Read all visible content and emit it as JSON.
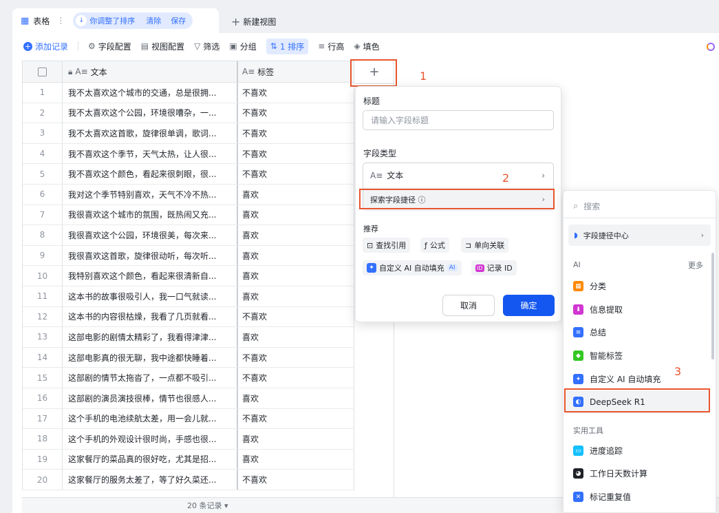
{
  "tabbar": {
    "tab_label": "表格",
    "sort_pill_text": "你调整了排序",
    "clear_label": "清除",
    "save_label": "保存",
    "new_view_label": "新建视图"
  },
  "toolbar": {
    "add_record": "添加记录",
    "field_config": "字段配置",
    "view_config": "视图配置",
    "filter": "筛选",
    "group": "分组",
    "sort": "1 排序",
    "row_height": "行高",
    "fill_color": "填色"
  },
  "table": {
    "col_text": "文本",
    "col_tag": "标签",
    "rows": [
      {
        "idx": "1",
        "text": "我不太喜欢这个城市的交通，总是很拥...",
        "tag": "不喜欢"
      },
      {
        "idx": "2",
        "text": "我不太喜欢这个公园，环境很嘈杂，一...",
        "tag": "不喜欢"
      },
      {
        "idx": "3",
        "text": "我不太喜欢这首歌，旋律很单调，歌词...",
        "tag": "不喜欢"
      },
      {
        "idx": "4",
        "text": "我不喜欢这个季节，天气太热，让人很...",
        "tag": "不喜欢"
      },
      {
        "idx": "5",
        "text": "我不喜欢这个颜色，看起来很刺眼，很...",
        "tag": "不喜欢"
      },
      {
        "idx": "6",
        "text": "我对这个季节特别喜欢，天气不冷不热...",
        "tag": "喜欢"
      },
      {
        "idx": "7",
        "text": "我很喜欢这个城市的氛围，既热闹又充...",
        "tag": "喜欢"
      },
      {
        "idx": "8",
        "text": "我很喜欢这个公园，环境很美，每次来...",
        "tag": "喜欢"
      },
      {
        "idx": "9",
        "text": "我很喜欢这首歌，旋律很动听，每次听...",
        "tag": "喜欢"
      },
      {
        "idx": "10",
        "text": "我特别喜欢这个颜色，看起来很清新自...",
        "tag": "喜欢"
      },
      {
        "idx": "11",
        "text": "这本书的故事很吸引人，我一口气就读...",
        "tag": "喜欢"
      },
      {
        "idx": "12",
        "text": "这本书的内容很枯燥，我看了几页就看...",
        "tag": "不喜欢"
      },
      {
        "idx": "13",
        "text": "这部电影的剧情太精彩了，我看得津津...",
        "tag": "喜欢"
      },
      {
        "idx": "14",
        "text": "这部电影真的很无聊，我中途都快睡着...",
        "tag": "不喜欢"
      },
      {
        "idx": "15",
        "text": "这部剧的情节太拖沓了，一点都不吸引...",
        "tag": "不喜欢"
      },
      {
        "idx": "16",
        "text": "这部剧的演员演技很棒，情节也很感人...",
        "tag": "喜欢"
      },
      {
        "idx": "17",
        "text": "这个手机的电池续航太差，用一会儿就...",
        "tag": "不喜欢"
      },
      {
        "idx": "18",
        "text": "这个手机的外观设计很时尚，手感也很...",
        "tag": "喜欢"
      },
      {
        "idx": "19",
        "text": "这家餐厅的菜品真的很好吃，尤其是招...",
        "tag": "喜欢"
      },
      {
        "idx": "20",
        "text": "这家餐厅的服务太差了，等了好久菜还...",
        "tag": "不喜欢"
      }
    ],
    "footer": "20 条记录 ▾"
  },
  "annotations": {
    "n1": "1",
    "n2": "2",
    "n3": "3"
  },
  "field_panel": {
    "title_label": "标题",
    "title_placeholder": "请输入字段标题",
    "type_label": "字段类型",
    "type_text": "文本",
    "explore_shortcut": "探索字段捷径 ⓘ",
    "recommend_label": "推荐",
    "rec_lookup": "查找引用",
    "rec_formula": "公式",
    "rec_oneway": "单向关联",
    "rec_ai_fill": "自定义 AI 自动填充",
    "rec_ai_badge": "AI",
    "rec_record_id": "记录 ID",
    "cancel": "取消",
    "confirm": "确定"
  },
  "shortcut_menu": {
    "search_placeholder": "搜索",
    "center": "字段捷径中心",
    "ai_section": "AI",
    "more": "更多",
    "ai_items": [
      "分类",
      "信息提取",
      "总结",
      "智能标签",
      "自定义 AI 自动填充",
      "DeepSeek R1"
    ],
    "tools_section": "实用工具",
    "tool_items": [
      "进度追踪",
      "工作日天数计算",
      "标记重复值"
    ]
  },
  "colors": {
    "accent": "#3370ff",
    "primary_button": "#1456f0",
    "annotation_red": "#e8552d"
  }
}
